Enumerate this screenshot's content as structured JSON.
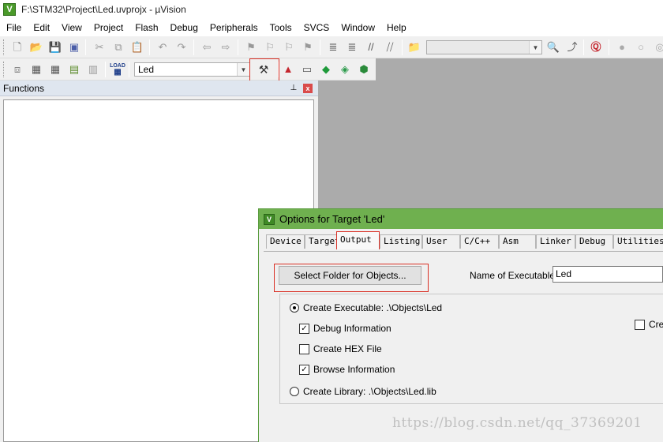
{
  "window": {
    "title": "F:\\STM32\\Project\\Led.uvprojx - µVision",
    "icon": "uvision-icon"
  },
  "menu": [
    "File",
    "Edit",
    "View",
    "Project",
    "Flash",
    "Debug",
    "Peripherals",
    "Tools",
    "SVCS",
    "Window",
    "Help"
  ],
  "toolbar": {
    "target_select": "Led",
    "search_combo": ""
  },
  "functions_panel": {
    "title": "Functions",
    "pin_glyph": "📌",
    "close_glyph": "x"
  },
  "dialog": {
    "title": "Options for Target 'Led'",
    "tabs": [
      "Device",
      "Target",
      "Output",
      "Listing",
      "User",
      "C/C++",
      "Asm",
      "Linker",
      "Debug",
      "Utilities"
    ],
    "active_tab": "Output",
    "select_folder_button": "Select Folder for Objects...",
    "name_of_executable_label": "Name of Executable:",
    "name_of_executable_value": "Led",
    "create_executable_label": "Create Executable:  .\\Objects\\Led",
    "debug_information": "Debug Information",
    "create_hex_file": "Create HEX File",
    "browse_information": "Browse Information",
    "create_library_label": "Create Library:  .\\Objects\\Led.lib",
    "truncated_right_checkbox": "Crea",
    "checked_mark": "✓"
  },
  "watermark": "https://blog.csdn.net/qq_37369201",
  "colors": {
    "dialog_title_bar": "#6fb04f",
    "highlight_red": "#d93025",
    "workspace_gray": "#ababab"
  }
}
